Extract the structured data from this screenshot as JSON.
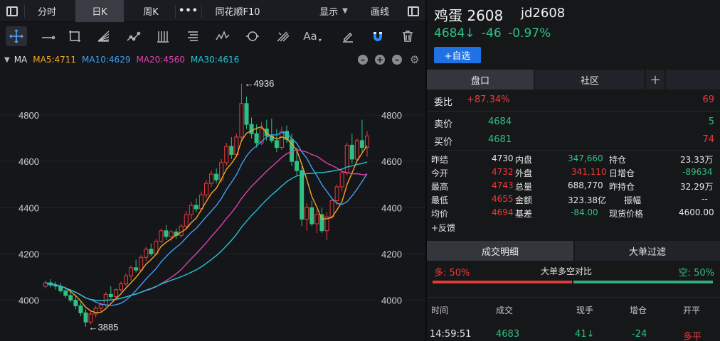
{
  "topbar": {
    "tab_fenshi": "分时",
    "tab_rik": "日K",
    "tab_zhouk": "周K",
    "more": "•••",
    "f10": "同花顺F10",
    "display": "显示",
    "draw": "画线"
  },
  "ma_bar": {
    "label": "MA",
    "ma5": "MA5:4711",
    "ma10": "MA10:4629",
    "ma20": "MA20:4560",
    "ma30": "MA30:4616",
    "colors": {
      "ma5": "#f5a623",
      "ma10": "#3ea0f0",
      "ma20": "#e040b0",
      "ma30": "#25c2d4"
    }
  },
  "chart_data": {
    "type": "candlestick",
    "y_ticks": [
      "4800",
      "4600",
      "4400",
      "4200",
      "4000"
    ],
    "ylim": [
      3860,
      4960
    ],
    "annotations": {
      "high": "←4936",
      "low": "←3885"
    },
    "colors": {
      "up": "#ee3b3b",
      "down": "#2fc184"
    },
    "candles": [
      [
        4060,
        4085,
        4050,
        4075
      ],
      [
        4075,
        4090,
        4055,
        4065
      ],
      [
        4065,
        4080,
        4045,
        4060
      ],
      [
        4060,
        4075,
        4030,
        4040
      ],
      [
        4040,
        4060,
        4010,
        4020
      ],
      [
        4020,
        4040,
        3990,
        4000
      ],
      [
        4000,
        4020,
        3960,
        3975
      ],
      [
        3975,
        3990,
        3930,
        3945
      ],
      [
        3945,
        3960,
        3885,
        3905
      ],
      [
        3905,
        3950,
        3895,
        3940
      ],
      [
        3940,
        3975,
        3925,
        3965
      ],
      [
        3965,
        3990,
        3945,
        3980
      ],
      [
        3980,
        4035,
        3970,
        4025
      ],
      [
        4025,
        4060,
        4005,
        4015
      ],
      [
        4015,
        4050,
        4000,
        4045
      ],
      [
        4045,
        4080,
        4035,
        4070
      ],
      [
        4070,
        4115,
        4060,
        4105
      ],
      [
        4105,
        4150,
        4085,
        4140
      ],
      [
        4140,
        4175,
        4120,
        4130
      ],
      [
        4130,
        4195,
        4125,
        4185
      ],
      [
        4185,
        4230,
        4170,
        4220
      ],
      [
        4220,
        4245,
        4190,
        4200
      ],
      [
        4200,
        4265,
        4195,
        4255
      ],
      [
        4255,
        4310,
        4245,
        4300
      ],
      [
        4300,
        4325,
        4260,
        4275
      ],
      [
        4275,
        4305,
        4255,
        4295
      ],
      [
        4295,
        4310,
        4265,
        4280
      ],
      [
        4280,
        4330,
        4270,
        4320
      ],
      [
        4320,
        4385,
        4310,
        4370
      ],
      [
        4370,
        4425,
        4350,
        4410
      ],
      [
        4410,
        4440,
        4380,
        4395
      ],
      [
        4395,
        4470,
        4385,
        4455
      ],
      [
        4455,
        4520,
        4440,
        4505
      ],
      [
        4505,
        4560,
        4490,
        4545
      ],
      [
        4545,
        4570,
        4505,
        4520
      ],
      [
        4520,
        4610,
        4510,
        4595
      ],
      [
        4595,
        4680,
        4580,
        4665
      ],
      [
        4665,
        4705,
        4610,
        4630
      ],
      [
        4630,
        4720,
        4620,
        4705
      ],
      [
        4705,
        4936,
        4690,
        4850
      ],
      [
        4850,
        4880,
        4740,
        4760
      ],
      [
        4760,
        4790,
        4700,
        4720
      ],
      [
        4720,
        4760,
        4660,
        4680
      ],
      [
        4680,
        4770,
        4670,
        4740
      ],
      [
        4740,
        4780,
        4690,
        4710
      ],
      [
        4710,
        4785,
        4680,
        4690
      ],
      [
        4690,
        4740,
        4640,
        4660
      ],
      [
        4660,
        4750,
        4650,
        4730
      ],
      [
        4730,
        4755,
        4680,
        4695
      ],
      [
        4695,
        4720,
        4580,
        4600
      ],
      [
        4600,
        4660,
        4540,
        4560
      ],
      [
        4560,
        4580,
        4320,
        4350
      ],
      [
        4350,
        4420,
        4300,
        4400
      ],
      [
        4400,
        4430,
        4320,
        4330
      ],
      [
        4330,
        4390,
        4290,
        4370
      ],
      [
        4370,
        4400,
        4290,
        4300
      ],
      [
        4300,
        4380,
        4260,
        4360
      ],
      [
        4360,
        4440,
        4350,
        4430
      ],
      [
        4430,
        4500,
        4410,
        4490
      ],
      [
        4490,
        4560,
        4470,
        4550
      ],
      [
        4550,
        4680,
        4540,
        4670
      ],
      [
        4670,
        4720,
        4590,
        4610
      ],
      [
        4610,
        4700,
        4600,
        4690
      ],
      [
        4690,
        4780,
        4640,
        4660
      ],
      [
        4660,
        4730,
        4620,
        4710
      ]
    ]
  },
  "quote": {
    "name": "鸡蛋",
    "contract": "2608",
    "code": "jd2608",
    "price": "4684↓",
    "change": "-46",
    "pct": "-0.97%",
    "add_fav": "+自选"
  },
  "tabs1": {
    "pankou": "盘口",
    "shequ": "社区",
    "plus": "+"
  },
  "orderbook": {
    "weibi_label": "委比",
    "weibi_value": "+87.34%",
    "weibi_qty": "69",
    "sell_label": "卖价",
    "sell_price": "4684",
    "sell_qty": "5",
    "buy_label": "买价",
    "buy_price": "4681",
    "buy_qty": "74"
  },
  "stats": [
    {
      "l1": "昨结",
      "v1": "4730",
      "l2": "内盘",
      "v2": "347,660",
      "l3": "持仓",
      "v3": "23.33万"
    },
    {
      "l1": "今开",
      "v1": "4732",
      "l2": "外盘",
      "v2": "341,110",
      "l3": "日增仓",
      "v3": "-89634"
    },
    {
      "l1": "最高",
      "v1": "4743",
      "l2": "总量",
      "v2": "688,770",
      "l3": "昨持仓",
      "v3": "32.29万"
    },
    {
      "l1": "最低",
      "v1": "4655",
      "l2": "金额",
      "v2": "323.38亿",
      "l3": "振幅",
      "v3": "--"
    },
    {
      "l1": "均价",
      "v1": "4694",
      "l2": "基差",
      "v2": "-84.00",
      "l3": "现货价格",
      "v3": "4600.00"
    }
  ],
  "feedback": "+反馈",
  "tabs2": {
    "detail": "成交明细",
    "bigorder": "大单过滤"
  },
  "ratio": {
    "long_label": "多: 50%",
    "title": "大单多空对比",
    "short_label": "空: 50%",
    "long": 0.5,
    "short": 0.5
  },
  "trade_headers": {
    "time": "时间",
    "deal": "成交",
    "qty": "现手",
    "oi": "增仓",
    "type": "开平"
  },
  "trade": {
    "time": "14:59:51",
    "price": "4683",
    "qty": "41↓",
    "oi": "-24",
    "type": "多平"
  }
}
